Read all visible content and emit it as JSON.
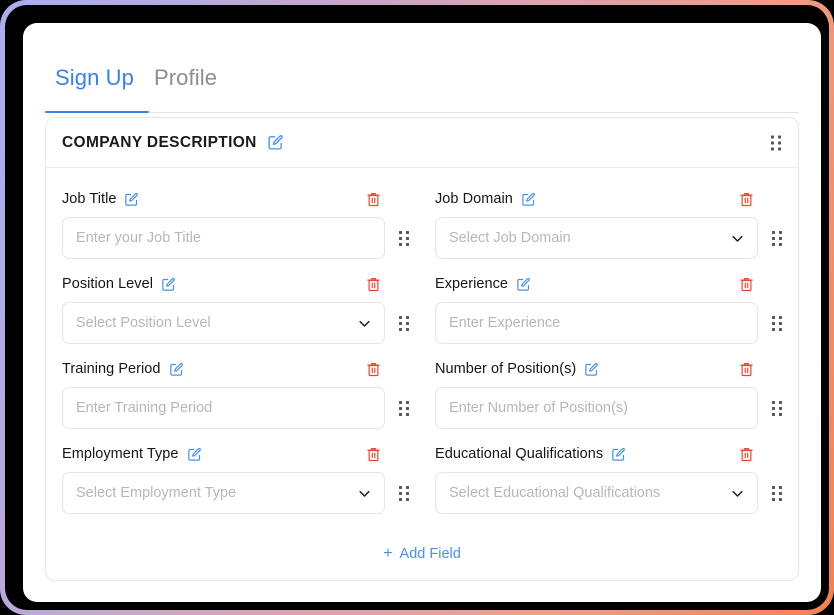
{
  "window": {
    "frame_gradient_start": "#a9aef0",
    "frame_gradient_end": "#f08254",
    "background": "#000000"
  },
  "tabs": {
    "items": [
      {
        "label": "Sign Up",
        "active": true
      },
      {
        "label": "Profile",
        "active": false
      }
    ],
    "active_color": "#3b82e8",
    "inactive_color": "#8d8d92"
  },
  "section": {
    "title": "COMPANY DESCRIPTION",
    "edit_icon": "pencil-square-icon",
    "drag_icon": "drag-handle-icon",
    "accent_color": "#4a90e8",
    "delete_color": "#f0442e"
  },
  "fields": [
    {
      "label": "Job Title",
      "type": "text",
      "placeholder": "Enter your Job Title",
      "value": "",
      "edit_icon": "pencil-square-icon",
      "delete_icon": "trash-icon",
      "drag_icon": "drag-handle-icon"
    },
    {
      "label": "Job Domain",
      "type": "select",
      "placeholder": "Select Job Domain",
      "value": "",
      "edit_icon": "pencil-square-icon",
      "delete_icon": "trash-icon",
      "drag_icon": "drag-handle-icon",
      "chevron_icon": "chevron-down-icon"
    },
    {
      "label": "Position Level",
      "type": "select",
      "placeholder": "Select Position Level",
      "value": "",
      "edit_icon": "pencil-square-icon",
      "delete_icon": "trash-icon",
      "drag_icon": "drag-handle-icon",
      "chevron_icon": "chevron-down-icon"
    },
    {
      "label": "Experience",
      "type": "text",
      "placeholder": "Enter Experience",
      "value": "",
      "edit_icon": "pencil-square-icon",
      "delete_icon": "trash-icon",
      "drag_icon": "drag-handle-icon"
    },
    {
      "label": "Training Period",
      "type": "text",
      "placeholder": "Enter Training Period",
      "value": "",
      "edit_icon": "pencil-square-icon",
      "delete_icon": "trash-icon",
      "drag_icon": "drag-handle-icon"
    },
    {
      "label": "Number of Position(s)",
      "type": "text",
      "placeholder": "Enter Number of Position(s)",
      "value": "",
      "edit_icon": "pencil-square-icon",
      "delete_icon": "trash-icon",
      "drag_icon": "drag-handle-icon"
    },
    {
      "label": "Employment Type",
      "type": "select",
      "placeholder": "Select Employment Type",
      "value": "",
      "edit_icon": "pencil-square-icon",
      "delete_icon": "trash-icon",
      "drag_icon": "drag-handle-icon",
      "chevron_icon": "chevron-down-icon"
    },
    {
      "label": "Educational Qualifications",
      "type": "select",
      "placeholder": "Select Educational Qualifications",
      "value": "",
      "edit_icon": "pencil-square-icon",
      "delete_icon": "trash-icon",
      "drag_icon": "drag-handle-icon",
      "chevron_icon": "chevron-down-icon"
    }
  ],
  "add_field": {
    "label": "Add Field",
    "plus": "+",
    "icon": "plus-icon"
  }
}
